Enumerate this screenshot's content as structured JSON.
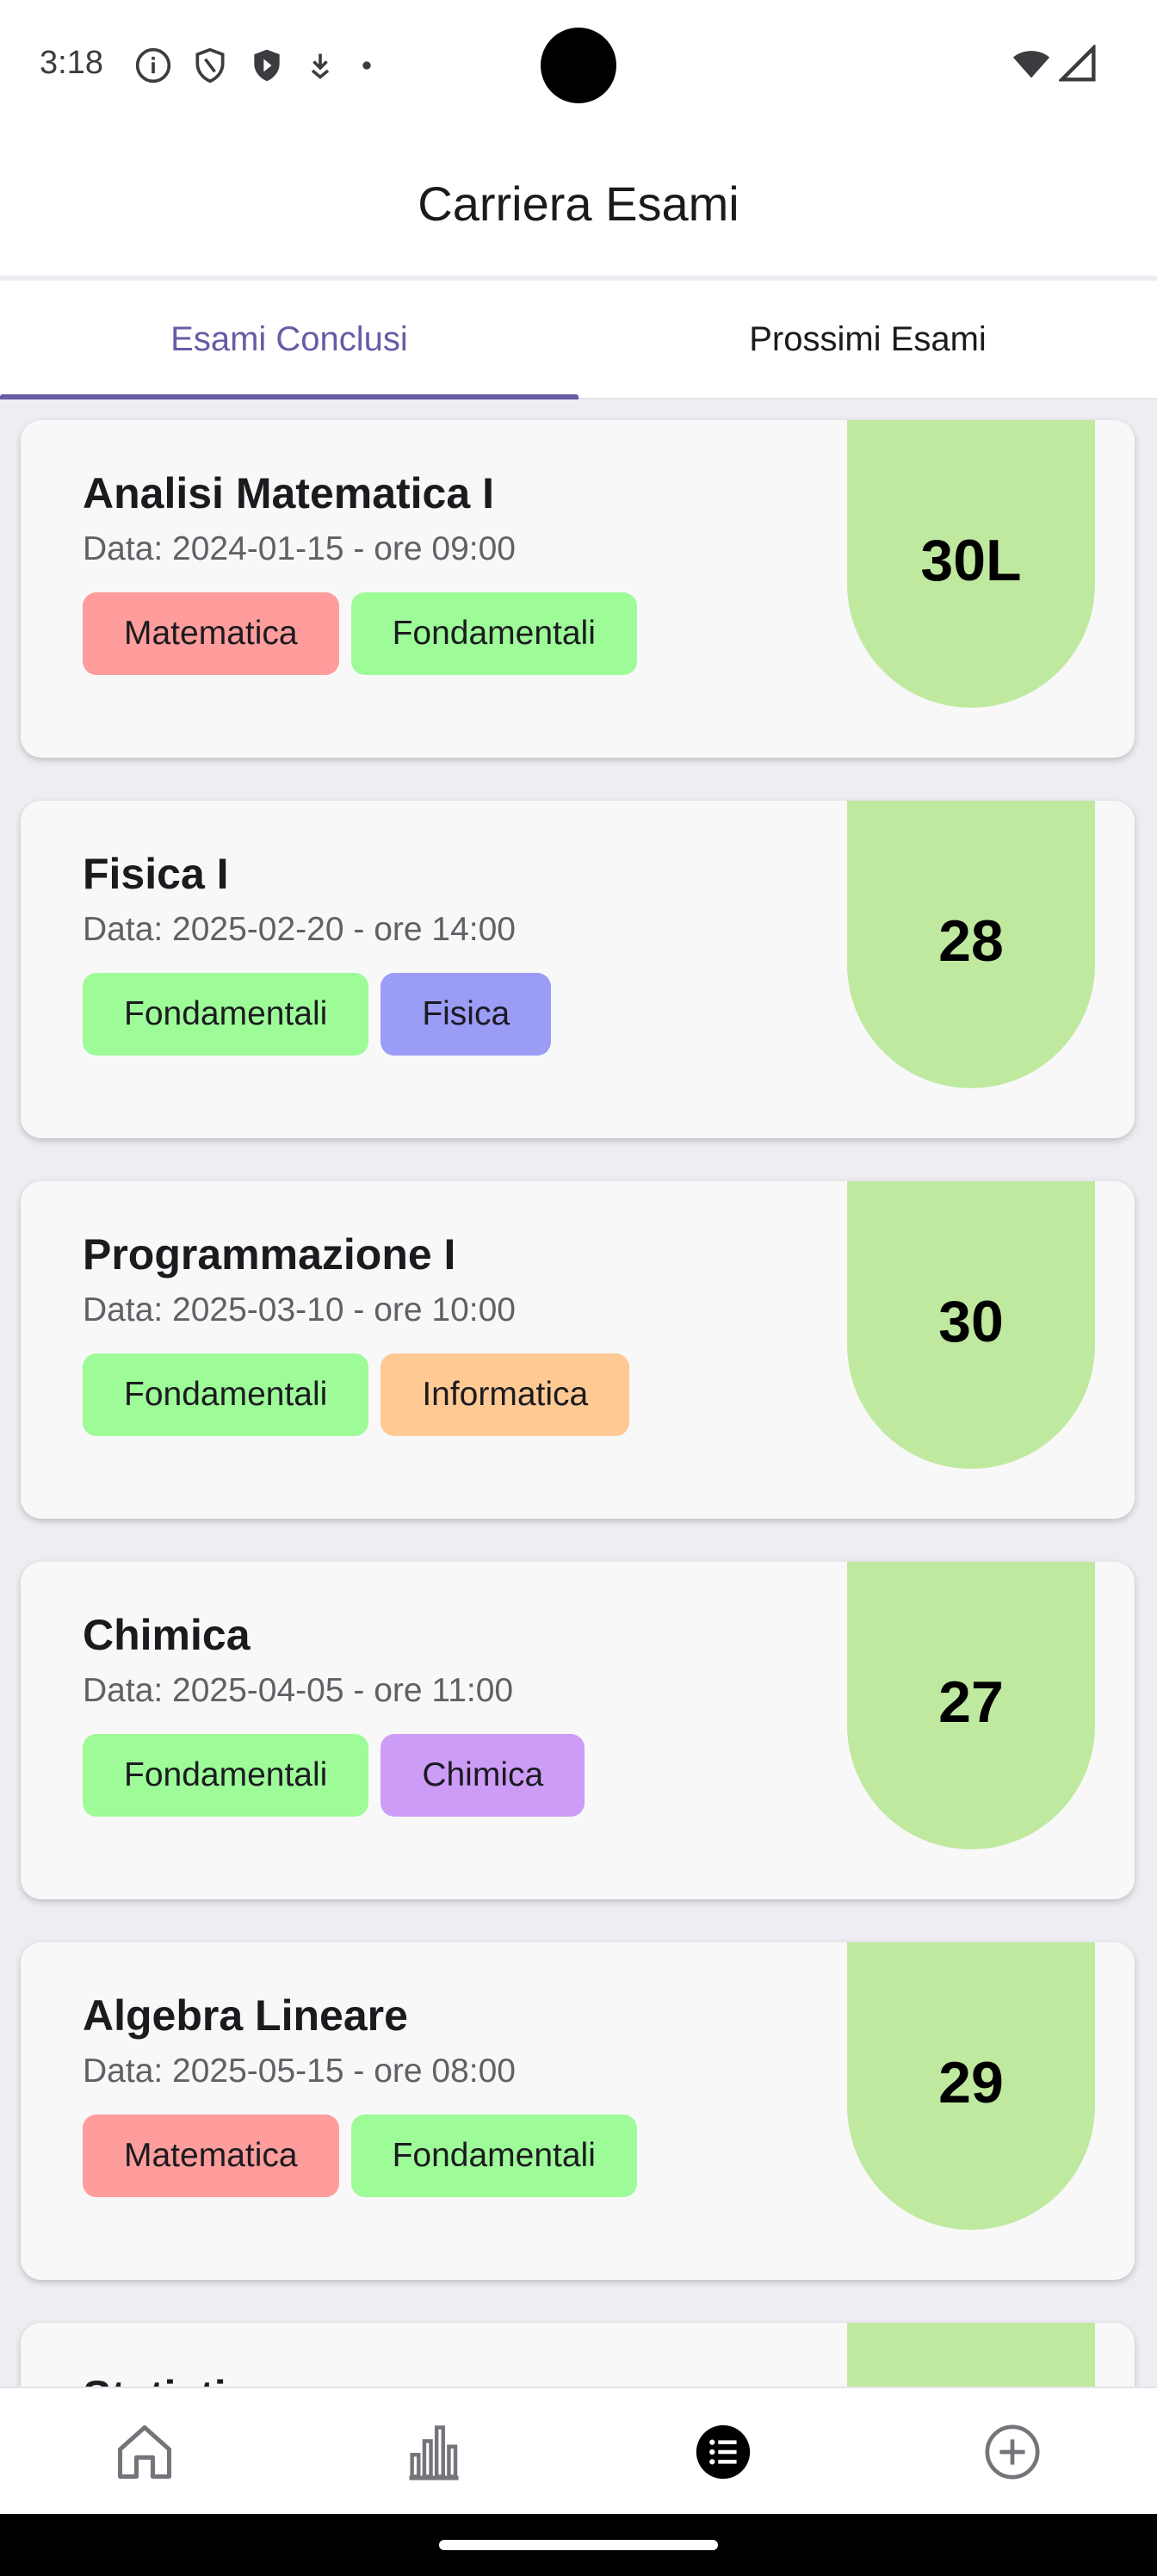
{
  "status_bar": {
    "time": "3:18",
    "icons": [
      "info-icon",
      "shield-icon",
      "play-protect-icon",
      "download-icon",
      "dot-icon"
    ],
    "right_icons": [
      "wifi-icon",
      "cellular-signal-icon"
    ]
  },
  "header": {
    "title": "Carriera Esami"
  },
  "tabs": [
    {
      "label": "Esami Conclusi",
      "active": true
    },
    {
      "label": "Prossimi Esami",
      "active": false
    }
  ],
  "colors": {
    "accent": "#6a5ba6",
    "grade_bg": "#c0e9a0",
    "tag_matematica": "#ff9c9c",
    "tag_fondamentali": "#9dfb98",
    "tag_fisica": "#9a9cf6",
    "tag_informatica": "#ffc994",
    "tag_chimica": "#cd9cf7"
  },
  "exams": [
    {
      "name": "Analisi Matematica I",
      "date": "Data: 2024-01-15 - ore 09:00",
      "tags": [
        {
          "label": "Matematica",
          "color": "#ff9c9c"
        },
        {
          "label": "Fondamentali",
          "color": "#9dfb98"
        }
      ],
      "grade": "30L"
    },
    {
      "name": "Fisica I",
      "date": "Data: 2025-02-20 - ore 14:00",
      "tags": [
        {
          "label": "Fondamentali",
          "color": "#9dfb98"
        },
        {
          "label": "Fisica",
          "color": "#9a9cf6"
        }
      ],
      "grade": "28"
    },
    {
      "name": "Programmazione I",
      "date": "Data: 2025-03-10 - ore 10:00",
      "tags": [
        {
          "label": "Fondamentali",
          "color": "#9dfb98"
        },
        {
          "label": "Informatica",
          "color": "#ffc994"
        }
      ],
      "grade": "30"
    },
    {
      "name": "Chimica",
      "date": "Data: 2025-04-05 - ore 11:00",
      "tags": [
        {
          "label": "Fondamentali",
          "color": "#9dfb98"
        },
        {
          "label": "Chimica",
          "color": "#cd9cf7"
        }
      ],
      "grade": "27"
    },
    {
      "name": "Algebra Lineare",
      "date": "Data: 2025-05-15 - ore 08:00",
      "tags": [
        {
          "label": "Matematica",
          "color": "#ff9c9c"
        },
        {
          "label": "Fondamentali",
          "color": "#9dfb98"
        }
      ],
      "grade": "29"
    },
    {
      "name": "Statistica",
      "date": "",
      "tags": [],
      "grade": ""
    }
  ],
  "bottom_nav": [
    {
      "icon": "home-icon",
      "active": false
    },
    {
      "icon": "bar-chart-icon",
      "active": false
    },
    {
      "icon": "list-icon",
      "active": true
    },
    {
      "icon": "add-circle-icon",
      "active": false
    }
  ]
}
